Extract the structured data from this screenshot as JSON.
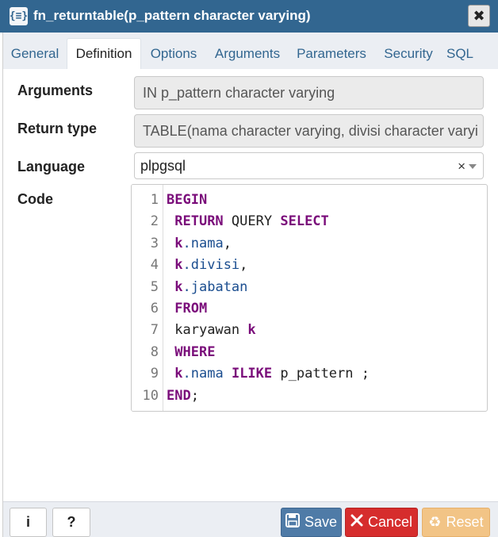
{
  "window": {
    "title": "fn_returntable(p_pattern character varying)",
    "icon": "{≡}",
    "close_icon": "✖"
  },
  "tabs": [
    {
      "label": "General",
      "active": false
    },
    {
      "label": "Definition",
      "active": true
    },
    {
      "label": "Options",
      "active": false
    },
    {
      "label": "Arguments",
      "active": false
    },
    {
      "label": "Parameters",
      "active": false
    },
    {
      "label": "Security",
      "active": false
    },
    {
      "label": "SQL",
      "active": false
    }
  ],
  "form": {
    "arguments_label": "Arguments",
    "arguments_value": "IN p_pattern character varying",
    "return_type_label": "Return type",
    "return_type_value": "TABLE(nama character varying, divisi character varyi",
    "language_label": "Language",
    "language_value": "plpgsql",
    "language_clear": "×",
    "code_label": "Code"
  },
  "code": {
    "lines": [
      "BEGIN",
      " RETURN QUERY SELECT",
      " k.nama,",
      " k.divisi,",
      " k.jabatan",
      " FROM",
      " karyawan k",
      " WHERE",
      " k.nama ILIKE p_pattern ;",
      "END;"
    ]
  },
  "footer": {
    "info_label": "i",
    "help_label": "?",
    "save_label": "Save",
    "cancel_label": "Cancel",
    "reset_label": "Reset"
  },
  "colors": {
    "titlebar": "#326690",
    "keyword": "#7a0c7a",
    "identifier": "#1a4d8f",
    "save": "#4f7ba7",
    "cancel": "#d62d2d",
    "reset": "#f2c486"
  }
}
